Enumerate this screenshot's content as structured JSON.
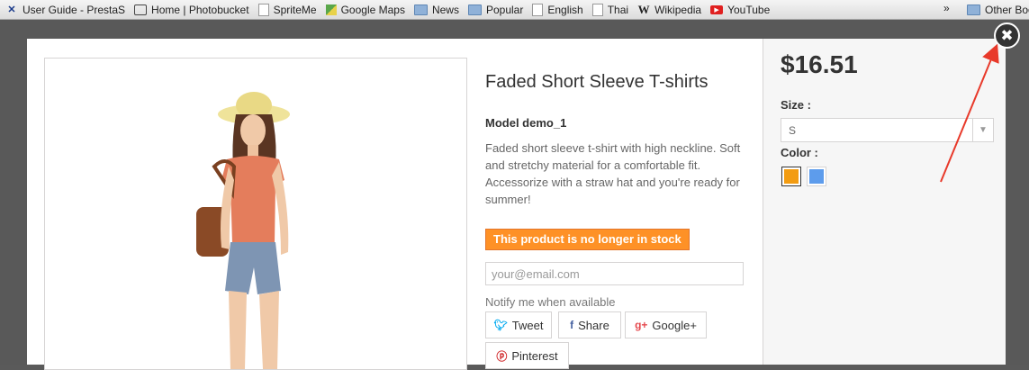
{
  "bookmarks": [
    {
      "label": "User Guide - PrestaS",
      "icon": "prestashop-icon"
    },
    {
      "label": "Home | Photobucket",
      "icon": "camera-icon"
    },
    {
      "label": "SpriteMe",
      "icon": "page-icon"
    },
    {
      "label": "Google Maps",
      "icon": "maps-icon"
    },
    {
      "label": "News",
      "icon": "folder-icon"
    },
    {
      "label": "Popular",
      "icon": "folder-icon"
    },
    {
      "label": "English",
      "icon": "page-icon"
    },
    {
      "label": "Thai",
      "icon": "page-icon"
    },
    {
      "label": "Wikipedia",
      "icon": "wikipedia-icon"
    },
    {
      "label": "YouTube",
      "icon": "youtube-icon"
    }
  ],
  "bookmarks_overflow": "»",
  "other_bookmarks": "Other Boo",
  "product": {
    "title": "Faded Short Sleeve T-shirts",
    "model": "Model demo_1",
    "description": "Faded short sleeve t-shirt with high neckline. Soft and stretchy material for a comfortable fit. Accessorize with a straw hat and you're ready for summer!",
    "stock_notice": "This product is no longer in stock",
    "email_placeholder": "your@email.com",
    "notify_label": "Notify me when available",
    "price": "$16.51",
    "size_label": "Size :",
    "size_value": "S",
    "color_label": "Color :",
    "colors": [
      "#f39c11",
      "#5d9cec"
    ]
  },
  "share": {
    "tweet": "Tweet",
    "share": "Share",
    "google": "Google+",
    "pinterest": "Pinterest"
  },
  "close_glyph": "✖",
  "accent": {
    "stock": "#fe9126",
    "annotation_arrow": "#e8392a"
  }
}
